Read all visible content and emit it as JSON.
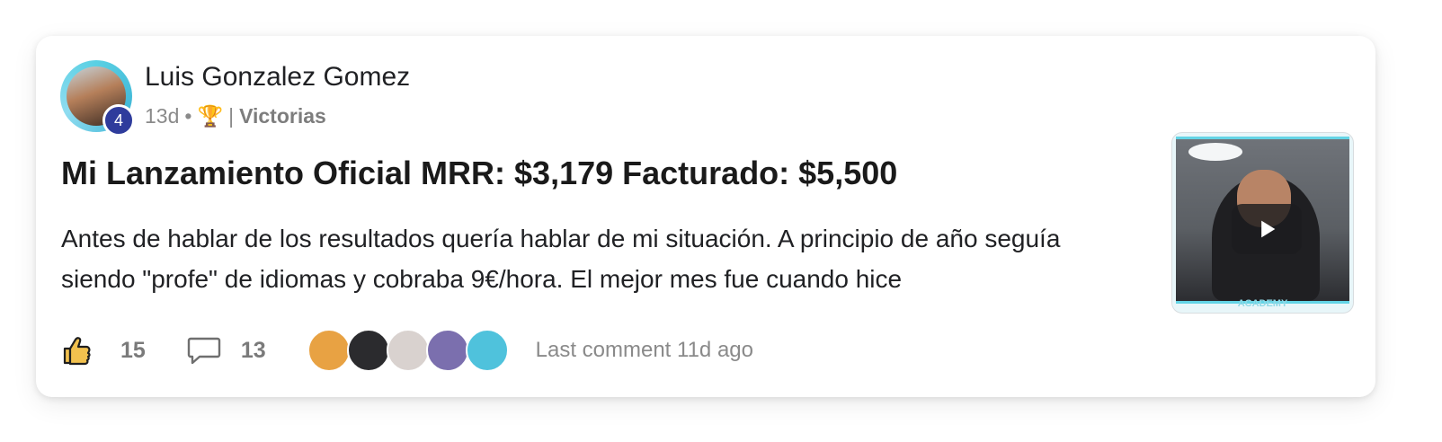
{
  "post": {
    "author": "Luis Gonzalez Gomez",
    "level": "4",
    "time_ago": "13d",
    "separator": "•",
    "trophy_emoji": "🏆",
    "category_prefix": "|",
    "category": "Victorias",
    "title": "Mi Lanzamiento Oficial MRR: $3,179 Facturado: $5,500",
    "excerpt": "Antes de hablar de los resultados quería hablar de mi situación. A principio de año seguía siendo \"profe\" de idiomas y cobraba 9€/hora. El mejor mes fue cuando hice",
    "thumbnail_caption": "ACADEMY",
    "likes": "15",
    "comments": "13",
    "last_comment": "Last comment 11d ago"
  },
  "commenter_avatars": [
    {
      "name": "commenter-avatar-1",
      "color": "#e8a243"
    },
    {
      "name": "commenter-avatar-2",
      "color": "#2b2b2e"
    },
    {
      "name": "commenter-avatar-3",
      "color": "#d9d2cf"
    },
    {
      "name": "commenter-avatar-4",
      "color": "#7b6fae"
    },
    {
      "name": "commenter-avatar-5",
      "color": "#4fc2dc"
    }
  ],
  "colors": {
    "level_badge": "#2f3c9c",
    "avatar_ring": "#5ad0e3",
    "thumbnail_accent": "#63d4e5",
    "like_icon": "#f2c14e"
  }
}
